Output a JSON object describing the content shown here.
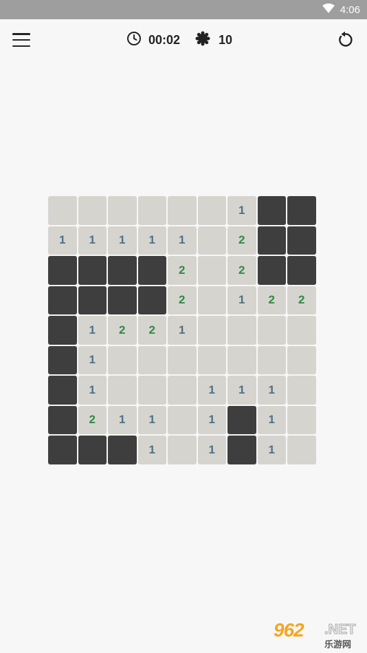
{
  "status_bar": {
    "time": "4:06",
    "wifi_icon": "wifi-icon"
  },
  "toolbar": {
    "menu_icon": "menu-icon",
    "clock_icon": "clock-icon",
    "timer": "00:02",
    "mine_icon": "mine-icon",
    "mines_remaining": "10",
    "restart_icon": "restart-icon"
  },
  "colors": {
    "covered": "#3e3e3e",
    "revealed": "#d6d4cf",
    "number_1": "#4d7186",
    "number_2": "#2f8a43"
  },
  "board": {
    "rows": 9,
    "cols": 9,
    "legend": "X = covered cell, 0 = revealed empty, number = revealed count",
    "cells": [
      [
        "0",
        "0",
        "0",
        "0",
        "0",
        "0",
        "1",
        "X",
        "X"
      ],
      [
        "1",
        "1",
        "1",
        "1",
        "1",
        "0",
        "2",
        "X",
        "X"
      ],
      [
        "X",
        "X",
        "X",
        "X",
        "2",
        "0",
        "2",
        "X",
        "X"
      ],
      [
        "X",
        "X",
        "X",
        "X",
        "2",
        "0",
        "1",
        "2",
        "2"
      ],
      [
        "X",
        "1",
        "2",
        "2",
        "1",
        "0",
        "0",
        "0",
        "0"
      ],
      [
        "X",
        "1",
        "0",
        "0",
        "0",
        "0",
        "0",
        "0",
        "0"
      ],
      [
        "X",
        "1",
        "0",
        "0",
        "0",
        "1",
        "1",
        "1",
        "0"
      ],
      [
        "X",
        "2",
        "1",
        "1",
        "0",
        "1",
        "X",
        "1",
        "0"
      ],
      [
        "X",
        "X",
        "X",
        "1",
        "0",
        "1",
        "X",
        "1",
        "0"
      ]
    ]
  },
  "watermark": {
    "digits": "962",
    "suffix": ".NET",
    "sub": "乐游网"
  }
}
